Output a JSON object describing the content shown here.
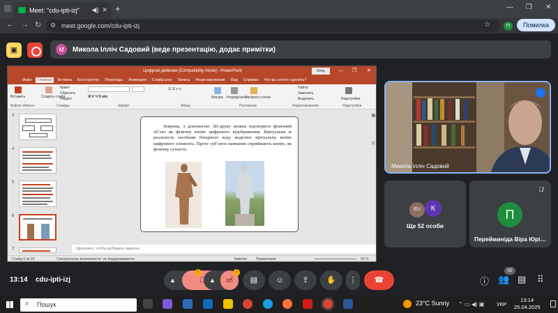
{
  "browser": {
    "tab_title": "Meet: \"cdu-ipti-izj\"",
    "url": "meet.google.com/cdu-ipti-izj",
    "profile_initial": "П",
    "error_button": "Помилка"
  },
  "banner": {
    "avatar_initial": "М",
    "text": "Микола Ілліч Садовий (веде презентацію, додає примітки)"
  },
  "powerpoint": {
    "title": "Цифрові двійники [Compatibility Mode] - PowerPoint",
    "signin": "Вход",
    "menus": [
      "Файл",
      "Главная",
      "Вставка",
      "Конструктор",
      "Переходы",
      "Анимация",
      "Слайд-шоу",
      "Запись",
      "Рецензирование",
      "Вид",
      "Справка",
      "Что вы хотите сделать?"
    ],
    "active_menu": "Главная",
    "groups": [
      "Буфер обмена",
      "Слайды",
      "Шрифт",
      "Абзац",
      "Рисование",
      "Редактирование",
      "Надстройки"
    ],
    "ribbon_buttons": {
      "paste": "Вставить",
      "new_slide": "Создать слайд",
      "layout": "Макет",
      "reset": "Сбросить",
      "section": "Раздел",
      "shapes": "Фигуры",
      "arrange": "Упорядочить",
      "quick_styles": "Экспресс-стили",
      "find": "Найти",
      "replace": "Заменить",
      "select": "Выделить",
      "addins": "Надстройки"
    },
    "thumb_numbers": [
      "3",
      "4",
      "5",
      "6",
      "7"
    ],
    "slide_text": "Зокрема, з допомогою 3D-друку можна відтворити фізичний об’єкт як фізичну копію цифрового відображення. Віртуальна ж реальність засобами бінарного коду моделює віртуальну копію цифрового елемента. Проте суб’єкти навчання сприймають копію, як фізичну сутність.",
    "notes_placeholder": "Щелкните, чтобы добавить заметки",
    "status_left": "Слайд 6 из 23",
    "status_access": "Специальные возможности: не поддерживается",
    "status_notes": "Заметки",
    "status_comments": "Примечания",
    "zoom": "92 %"
  },
  "participants": {
    "main_name": "Микола Ілліч Садовий",
    "others_initial": "К",
    "others_label": "Ще 52 особи",
    "vira_initial": "П",
    "vira_name": "Перейминіда Віра Юрі…"
  },
  "bottom": {
    "time": "13:14",
    "meeting_code": "cdu-ipti-izj",
    "participant_count": "55",
    "warn": "!"
  },
  "taskbar": {
    "search": "Пошук",
    "weather": "23°C  Sunny",
    "lang": "УКР",
    "clock_time": "13:14",
    "clock_date": "25.04.2025"
  },
  "colors": {
    "accent": "#8ab4f8",
    "leave": "#ea4335",
    "ppt": "#b7472a",
    "avatar_green": "#1e8e3e"
  }
}
